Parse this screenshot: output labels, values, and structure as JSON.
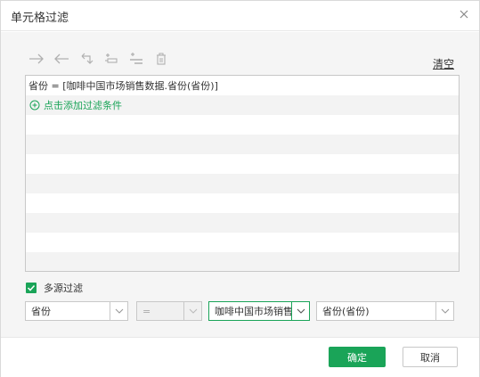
{
  "dialog": {
    "title": "单元格过滤",
    "close_icon": "close-icon"
  },
  "toolbar": {
    "icons": [
      "arrow-right-icon",
      "arrow-left-icon",
      "swap-return-icon",
      "insert-above-icon",
      "insert-below-icon",
      "delete-icon"
    ],
    "clear_label": "清空"
  },
  "filter_list": {
    "condition_text": "省份 = [咖啡中国市场销售数据.省份(省份)]",
    "add_label": "点击添加过滤条件",
    "accent": "#1aa458"
  },
  "multi_source": {
    "checked": true,
    "label": "多源过滤"
  },
  "selectors": {
    "field": "省份",
    "operator": "=",
    "source": "咖啡中国市场销售",
    "target_field": "省份(省份)"
  },
  "footer": {
    "ok_label": "确定",
    "cancel_label": "取消"
  }
}
